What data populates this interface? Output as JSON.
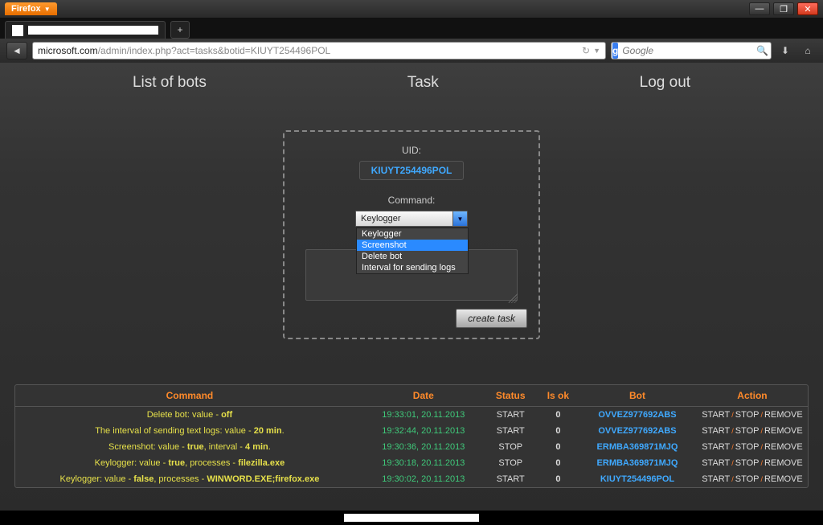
{
  "browser": {
    "name": "Firefox",
    "url_host": "microsoft.com",
    "url_path": "/admin/index.php?act=tasks&botid=KIUYT254496POL",
    "search_placeholder": "Google",
    "search_logo_letter": "g"
  },
  "nav": {
    "list_bots": "List of bots",
    "task": "Task",
    "logout": "Log out"
  },
  "task_form": {
    "uid_label": "UID:",
    "uid_value": "KIUYT254496POL",
    "command_label": "Command:",
    "command_selected": "Keylogger",
    "command_options": [
      "Keylogger",
      "Screenshot",
      "Delete bot",
      "Interval for sending logs"
    ],
    "command_highlight_index": 1,
    "create_button": "create task"
  },
  "table": {
    "headers": {
      "command": "Command",
      "date": "Date",
      "status": "Status",
      "is_ok": "Is ok",
      "bot": "Bot",
      "action": "Action"
    },
    "actions": {
      "start": "START",
      "stop": "STOP",
      "remove": "REMOVE"
    },
    "rows": [
      {
        "cmd_html": "Delete bot: value - <b>off</b>",
        "date": "19:33:01, 20.11.2013",
        "status": "START",
        "ok": "0",
        "bot": "OVVEZ977692ABS"
      },
      {
        "cmd_html": "The interval of sending text logs: value - <b>20 min</b>.",
        "date": "19:32:44, 20.11.2013",
        "status": "START",
        "ok": "0",
        "bot": "OVVEZ977692ABS"
      },
      {
        "cmd_html": "Screenshot: value - <b>true</b>, interval - <b>4 min</b>.",
        "date": "19:30:36, 20.11.2013",
        "status": "STOP",
        "ok": "0",
        "bot": "ERMBA369871MJQ"
      },
      {
        "cmd_html": "Keylogger: value - <b>true</b>, processes - <b>filezilla.exe</b>",
        "date": "19:30:18, 20.11.2013",
        "status": "STOP",
        "ok": "0",
        "bot": "ERMBA369871MJQ"
      },
      {
        "cmd_html": "Keylogger: value - <b>false</b>, processes - <b>WINWORD.EXE;firefox.exe</b>",
        "date": "19:30:02, 20.11.2013",
        "status": "START",
        "ok": "0",
        "bot": "KIUYT254496POL"
      }
    ]
  }
}
